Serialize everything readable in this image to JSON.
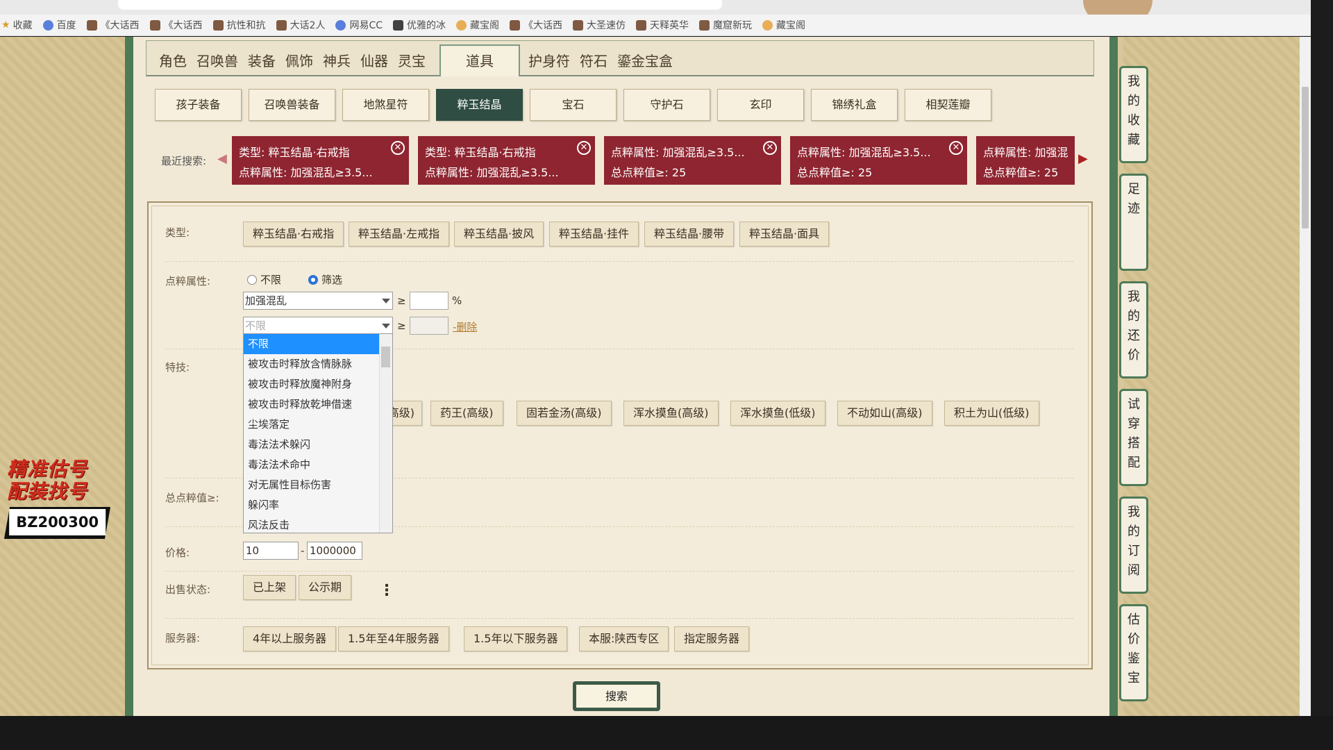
{
  "browser": {
    "bookmarks": [
      {
        "label": "收藏",
        "icon": "star-icon"
      },
      {
        "label": "百度",
        "icon": "baidu-icon"
      },
      {
        "label": "《大话西",
        "icon": "game-icon"
      },
      {
        "label": "《大话西",
        "icon": "game-icon"
      },
      {
        "label": "抗性和抗",
        "icon": "doc-icon"
      },
      {
        "label": "大话2人",
        "icon": "game-icon"
      },
      {
        "label": "网易CC",
        "icon": "cc-icon"
      },
      {
        "label": "优雅的冰",
        "icon": "tiktok-icon"
      },
      {
        "label": "藏宝阁",
        "icon": "cbg-icon"
      },
      {
        "label": "《大话西",
        "icon": "game-icon"
      },
      {
        "label": "大圣速仿",
        "icon": "game-icon"
      },
      {
        "label": "天释英华",
        "icon": "game-icon"
      },
      {
        "label": "魔窟新玩",
        "icon": "game-icon"
      },
      {
        "label": "藏宝阁",
        "icon": "cbg-icon"
      }
    ]
  },
  "main_tabs": [
    "角色",
    "召唤兽",
    "装备",
    "佩饰",
    "神兵",
    "仙器",
    "灵宝",
    "道具",
    "护身符",
    "符石",
    "鎏金宝盒"
  ],
  "active_main_tab": "道具",
  "sub_tabs": [
    "孩子装备",
    "召唤兽装备",
    "地煞星符",
    "粹玉结晶",
    "宝石",
    "守护石",
    "玄印",
    "锦绣礼盒",
    "相契莲瓣"
  ],
  "active_sub_tab": "粹玉结晶",
  "recent": {
    "label": "最近搜索:",
    "chips": [
      {
        "line1": "类型: 粹玉结晶·右戒指",
        "line2": "点粹属性: 加强混乱≥3.5..."
      },
      {
        "line1": "类型: 粹玉结晶·右戒指",
        "line2": "点粹属性: 加强混乱≥3.5..."
      },
      {
        "line1": "点粹属性: 加强混乱≥3.5...",
        "line2": "总点粹值≥: 25"
      },
      {
        "line1": "点粹属性: 加强混乱≥3.5...",
        "line2": "总点粹值≥: 25"
      },
      {
        "line1": "点粹属性: 加强混",
        "line2": "总点粹值≥: 25"
      }
    ]
  },
  "filters": {
    "type_label": "类型:",
    "types": [
      "粹玉结晶·右戒指",
      "粹玉结晶·左戒指",
      "粹玉结晶·披风",
      "粹玉结晶·挂件",
      "粹玉结晶·腰带",
      "粹玉结晶·面具"
    ],
    "attr_label": "点粹属性:",
    "radio_unlimited": "不限",
    "radio_filter": "筛选",
    "attr1_value": "加强混乱",
    "ge": "≥",
    "percent": "%",
    "attr2_placeholder": "不限",
    "delete_label": "-删除",
    "dropdown_options": [
      "不限",
      "被攻击时释放含情脉脉",
      "被攻击时释放魔神附身",
      "被攻击时释放乾坤借速",
      "尘埃落定",
      "毒法法术躲闪",
      "毒法法术命中",
      "对无属性目标伤害",
      "躲闪率",
      "风法反击"
    ],
    "skill_label": "特技:",
    "skills": [
      "药王(高级)",
      "固若金汤(高级)",
      "浑水摸鱼(高级)",
      "浑水摸鱼(低级)",
      "不动如山(高级)",
      "积土为山(低级)"
    ],
    "skill_partial": "高级)",
    "total_label": "总点粹值≥:",
    "price_label": "价格:",
    "price_min": "10",
    "price_max": "1000000",
    "price_dash": "-",
    "status_label": "出售状态:",
    "status_options": [
      "已上架",
      "公示期"
    ],
    "server_label": "服务器:",
    "servers": [
      "4年以上服务器",
      "1.5年至4年服务器",
      "1.5年以下服务器",
      "本服:陕西专区",
      "指定服务器"
    ]
  },
  "search_button": "搜索",
  "right_nav": [
    "我的收藏",
    "足迹",
    "我的还价",
    "试穿搭配",
    "我的订阅",
    "估价鉴宝"
  ],
  "promo": {
    "line1": "精准估号",
    "line2": "配装找号",
    "code": "BZ200300"
  },
  "colors": {
    "chip": "#8e2530",
    "active_tab": "#2f4d43",
    "frame_green": "#4e7a57",
    "highlight": "#1e90ff"
  }
}
